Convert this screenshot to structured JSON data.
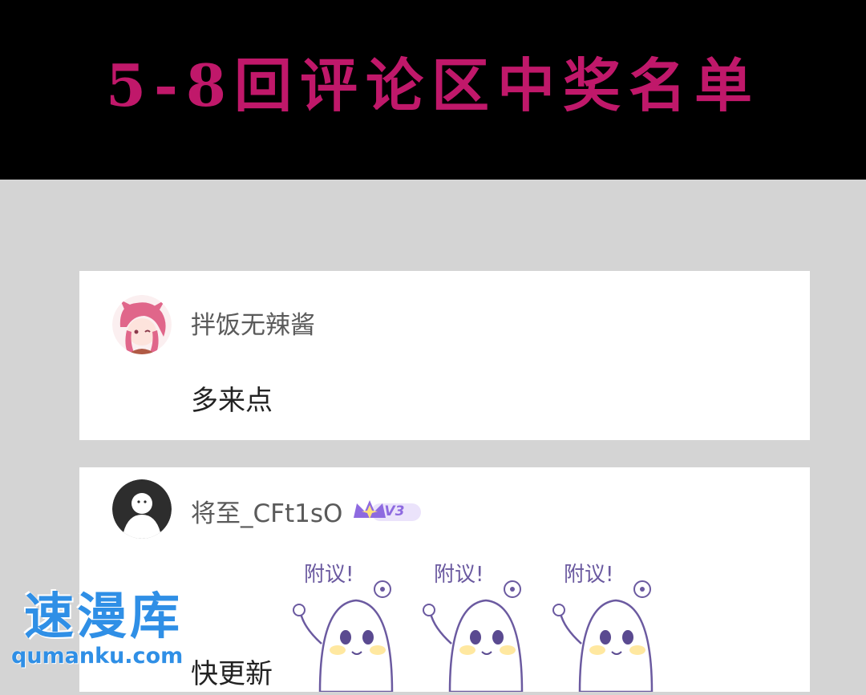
{
  "banner": {
    "title": "5-8回评论区中奖名单"
  },
  "comments": [
    {
      "username": "拌饭无辣酱",
      "text": "多来点"
    },
    {
      "username": "将至_CFt1sO",
      "vip_label": "V3",
      "text": "快更新",
      "sticker_caption": "附议!"
    }
  ],
  "watermark": {
    "brand": "速漫库",
    "url": "qumanku.com"
  },
  "colors": {
    "banner_text": "#c0186a",
    "watermark": "#2f8fe6",
    "vip_purple": "#8e6ae0"
  }
}
